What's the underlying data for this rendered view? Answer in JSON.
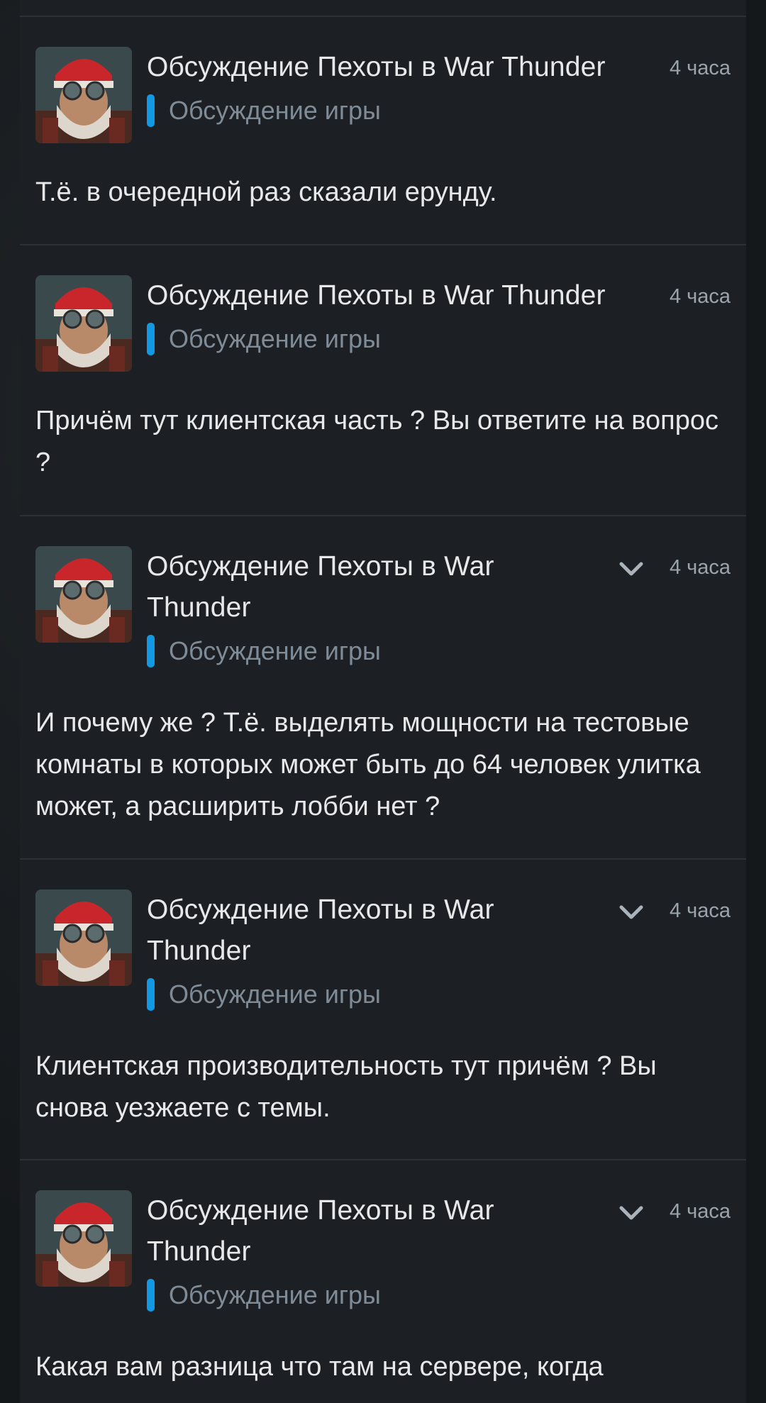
{
  "thread": {
    "title": "Обсуждение Пехоты в War Thunder",
    "category": "Обсуждение игры",
    "category_color": "#1398e4"
  },
  "posts": [
    {
      "title": "Обсуждение Пехоты в War Thunder",
      "category": "Обсуждение игры",
      "time": "4 часа",
      "has_menu": false,
      "text": "Т.ё. в очередной раз сказали ерунду."
    },
    {
      "title": "Обсуждение Пехоты в War Thunder",
      "category": "Обсуждение игры",
      "time": "4 часа",
      "has_menu": false,
      "text": "Причём тут клиентская часть ? Вы ответите на вопрос ?"
    },
    {
      "title": "Обсуждение Пехоты в War Thunder",
      "category": "Обсуждение игры",
      "time": "4 часа",
      "has_menu": true,
      "text": "И почему же ? Т.ё. выделять мощности на тестовые комнаты в которых может быть до 64 человек улитка может, а расширить лобби нет ?"
    },
    {
      "title": "Обсуждение Пехоты в War Thunder",
      "category": "Обсуждение игры",
      "time": "4 часа",
      "has_menu": true,
      "text": "Клиентская производительность тут причём ? Вы снова уезжаете с темы."
    },
    {
      "title": "Обсуждение Пехоты в War Thunder",
      "category": "Обсуждение игры",
      "time": "4 часа",
      "has_menu": true,
      "text": "Какая вам разница что там на сервере, когда"
    }
  ],
  "icons": {
    "avatar": "santa-pilot-avatar",
    "menu": "chevron-down-icon"
  }
}
